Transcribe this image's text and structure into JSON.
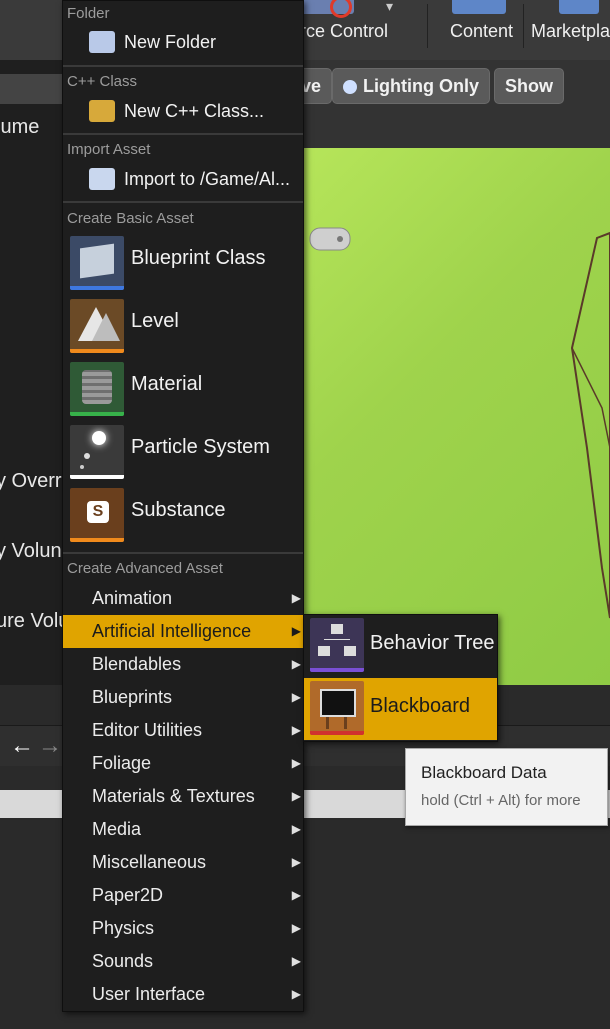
{
  "toolbar": {
    "source_control_label": "rce Control",
    "content_label": "Content",
    "marketplace_label": "Marketpla"
  },
  "viewport": {
    "buttons": [
      "ve",
      "Lighting Only",
      "Show"
    ]
  },
  "left_panel": {
    "items": [
      "lume",
      "y Overr",
      "y Volun",
      "ure Volu"
    ]
  },
  "menu": {
    "sections": {
      "folder": "Folder",
      "cpp_class": "C++ Class",
      "import_asset": "Import Asset",
      "basic_asset": "Create Basic Asset",
      "advanced_asset": "Create Advanced Asset"
    },
    "new_folder": "New Folder",
    "new_cpp_class": "New C++ Class...",
    "import_to": "Import to /Game/Al...",
    "basic_assets": [
      {
        "label": "Blueprint Class",
        "icon": "blueprint-class-icon",
        "bar_color": "#3e78e0"
      },
      {
        "label": "Level",
        "icon": "level-icon",
        "bar_color": "#f08a1c"
      },
      {
        "label": "Material",
        "icon": "material-icon",
        "bar_color": "#37b24a"
      },
      {
        "label": "Particle System",
        "icon": "particle-system-icon",
        "bar_color": "#ffffff"
      },
      {
        "label": "Substance",
        "icon": "substance-icon",
        "bar_color": "#f08a1c"
      }
    ],
    "advanced_items": [
      "Animation",
      "Artificial Intelligence",
      "Blendables",
      "Blueprints",
      "Editor Utilities",
      "Foliage",
      "Materials & Textures",
      "Media",
      "Miscellaneous",
      "Paper2D",
      "Physics",
      "Sounds",
      "User Interface"
    ],
    "active_advanced_index": 1
  },
  "submenu": {
    "items": [
      {
        "label": "Behavior Tree",
        "icon": "behavior-tree-icon",
        "bar_color": "#7a4fd6"
      },
      {
        "label": "Blackboard",
        "icon": "blackboard-icon",
        "bar_color": "#d0322e"
      }
    ],
    "active_index": 1
  },
  "tooltip": {
    "title": "Blackboard Data",
    "hint": "hold (Ctrl + Alt) for more"
  },
  "colors": {
    "accent": "#e0a400",
    "menu_bg": "#1e1e1e",
    "viewport_green": "#9fd34c"
  }
}
